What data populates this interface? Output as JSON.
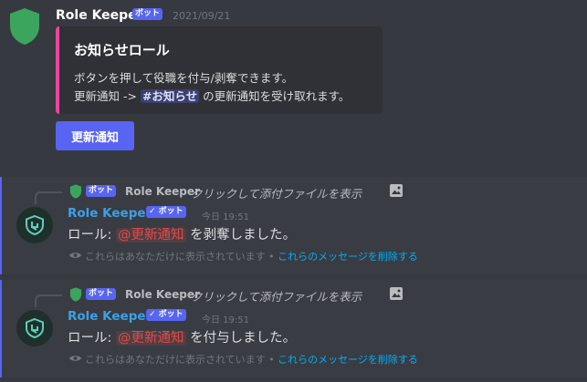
{
  "message1": {
    "author": "Role Keeper",
    "bot_tag": "ボット",
    "timestamp": "2021/09/21",
    "embed": {
      "title": "お知らせロール",
      "line1": "ボタンを押して役職を付与/剥奪できます。",
      "line2_prefix": "更新通知 ->",
      "line2_channel": "#お知らせ",
      "line2_suffix": "の更新通知を受け取れます。",
      "accent_color": "#eb459e"
    },
    "button_label": "更新通知"
  },
  "ephemeral": [
    {
      "reply_bot_tag": "ボット",
      "reply_author": "Role Keeper",
      "reply_text": "クリックして添付ファイルを表示",
      "author": "Role Keeper",
      "bot_tag": "✓ ボット",
      "timestamp": "今日 19:51",
      "content_prefix": "ロール:",
      "role_mention": "@更新通知",
      "content_suffix": "を剥奪しました。",
      "note": "これらはあなただけに表示されています •",
      "delete_link": "これらのメッセージを削除する"
    },
    {
      "reply_bot_tag": "ボット",
      "reply_author": "Role Keeper",
      "reply_text": "クリックして添付ファイルを表示",
      "author": "Role Keeper",
      "bot_tag": "✓ ボット",
      "timestamp": "今日 19:51",
      "content_prefix": "ロール:",
      "role_mention": "@更新通知",
      "content_suffix": "を付与しました。",
      "note": "これらはあなただけに表示されています •",
      "delete_link": "これらのメッセージを削除する"
    }
  ],
  "icons": [
    "shield-icon",
    "image-icon",
    "avatar-icon",
    "eye-icon"
  ],
  "colors": {
    "blurple": "#5865f2",
    "link": "#00aff4",
    "role": "#e04b4b",
    "bot_name": "#3ba1e6"
  }
}
